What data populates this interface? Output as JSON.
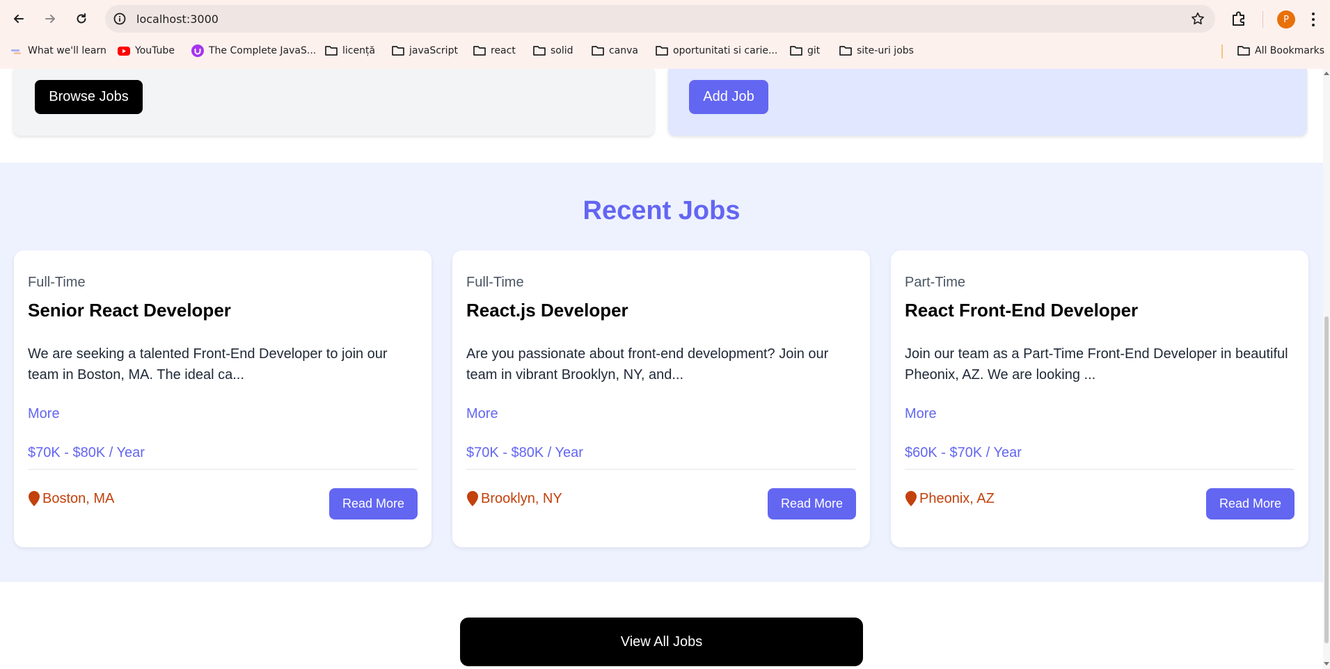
{
  "browser": {
    "url": "localhost:3000",
    "avatar_letter": "P",
    "bookmarks": [
      {
        "label": "What we'll learn",
        "icon": "page-icon"
      },
      {
        "label": "YouTube",
        "icon": "youtube-icon"
      },
      {
        "label": "The Complete JavaS...",
        "icon": "udemy-icon"
      },
      {
        "label": "licență",
        "icon": "folder-icon"
      },
      {
        "label": "javaScript",
        "icon": "folder-icon"
      },
      {
        "label": "react",
        "icon": "folder-icon"
      },
      {
        "label": "solid",
        "icon": "folder-icon"
      },
      {
        "label": "canva",
        "icon": "folder-icon"
      },
      {
        "label": "oportunitati si carie...",
        "icon": "folder-icon"
      },
      {
        "label": "git",
        "icon": "folder-icon"
      },
      {
        "label": "site-uri jobs",
        "icon": "folder-icon"
      }
    ],
    "all_bookmarks": "All Bookmarks"
  },
  "hero": {
    "browse_jobs": "Browse Jobs",
    "add_job": "Add Job"
  },
  "recent": {
    "title": "Recent Jobs",
    "jobs": [
      {
        "type": "Full-Time",
        "title": "Senior React Developer",
        "description": "We are seeking a talented Front-End Developer to join our team in Boston, MA. The ideal ca...",
        "more": "More",
        "salary": "$70K - $80K / Year",
        "location": "Boston, MA",
        "read_more": "Read More"
      },
      {
        "type": "Full-Time",
        "title": "React.js Developer",
        "description": "Are you passionate about front-end development? Join our team in vibrant Brooklyn, NY, and...",
        "more": "More",
        "salary": "$70K - $80K / Year",
        "location": "Brooklyn, NY",
        "read_more": "Read More"
      },
      {
        "type": "Part-Time",
        "title": "React Front-End Developer",
        "description": "Join our team as a Part-Time Front-End Developer in beautiful Pheonix, AZ. We are looking ...",
        "more": "More",
        "salary": "$60K - $70K / Year",
        "location": "Pheonix, AZ",
        "read_more": "Read More"
      }
    ]
  },
  "view_all": "View All Jobs",
  "colors": {
    "accent": "#6366f1",
    "location": "#c2410c",
    "section_bg": "#eef2ff"
  }
}
